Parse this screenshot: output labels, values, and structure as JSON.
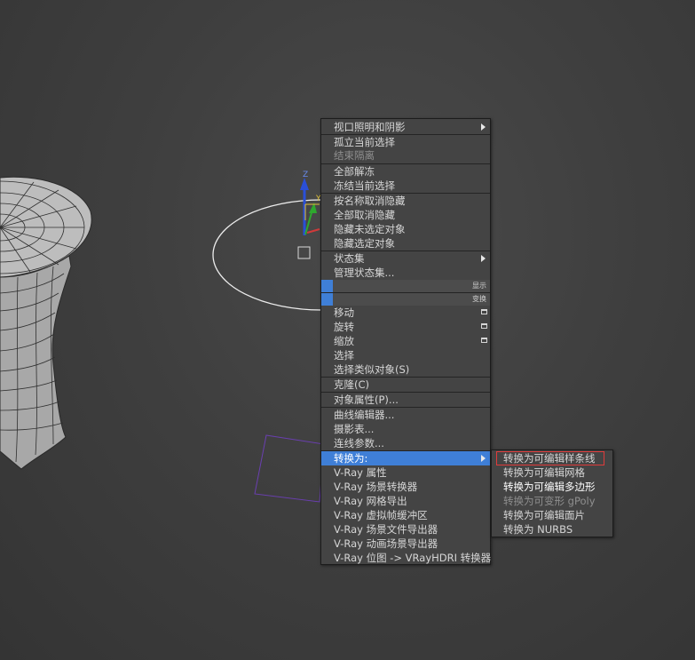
{
  "quad_menu": {
    "items": [
      {
        "label": "视口照明和阴影",
        "submenu": true
      },
      {
        "label": "孤立当前选择"
      },
      {
        "label": "结束隔离",
        "disabled": true
      },
      {
        "label": "全部解冻"
      },
      {
        "label": "冻结当前选择"
      },
      {
        "label": "按名称取消隐藏"
      },
      {
        "label": "全部取消隐藏"
      },
      {
        "label": "隐藏未选定对象"
      },
      {
        "label": "隐藏选定对象"
      },
      {
        "label": "状态集",
        "submenu": true
      },
      {
        "label": "管理状态集..."
      },
      {
        "label": "移动",
        "options": true
      },
      {
        "label": "旋转",
        "options": true
      },
      {
        "label": "缩放",
        "options": true
      },
      {
        "label": "选择"
      },
      {
        "label": "选择类似对象(S)"
      },
      {
        "label": "克隆(C)"
      },
      {
        "label": "对象属性(P)..."
      },
      {
        "label": "曲线编辑器..."
      },
      {
        "label": "摄影表..."
      },
      {
        "label": "连线参数..."
      },
      {
        "label": "转换为:",
        "submenu": true,
        "selected": true
      },
      {
        "label": "V-Ray 属性"
      },
      {
        "label": "V-Ray 场景转换器"
      },
      {
        "label": "V-Ray 网格导出"
      },
      {
        "label": "V-Ray 虚拟帧缓冲区"
      },
      {
        "label": "V-Ray 场景文件导出器"
      },
      {
        "label": "V-Ray 动画场景导出器"
      },
      {
        "label": "V-Ray 位图 -> VRayHDRI 转换器"
      }
    ],
    "quadrant_labels": {
      "display": "显示",
      "transform": "变换"
    }
  },
  "convert_submenu": {
    "items": [
      {
        "label": "转换为可编辑样条线",
        "highlighted": true
      },
      {
        "label": "转换为可编辑网格"
      },
      {
        "label": "转换为可编辑多边形"
      },
      {
        "label": "转换为可变形 gPoly",
        "disabled": true
      },
      {
        "label": "转换为可编辑面片"
      },
      {
        "label": "转换为 NURBS"
      }
    ]
  },
  "gizmo": {
    "axis_z": "Z",
    "axis_y": "Y"
  },
  "colors": {
    "viewport_bg": "#3f3f3f",
    "menu_bg": "#444444",
    "selection_blue": "#3f7fd7",
    "highlight_red": "#e03b3b",
    "circle_white": "#ececec",
    "plane_purple": "#6a3fb0"
  }
}
